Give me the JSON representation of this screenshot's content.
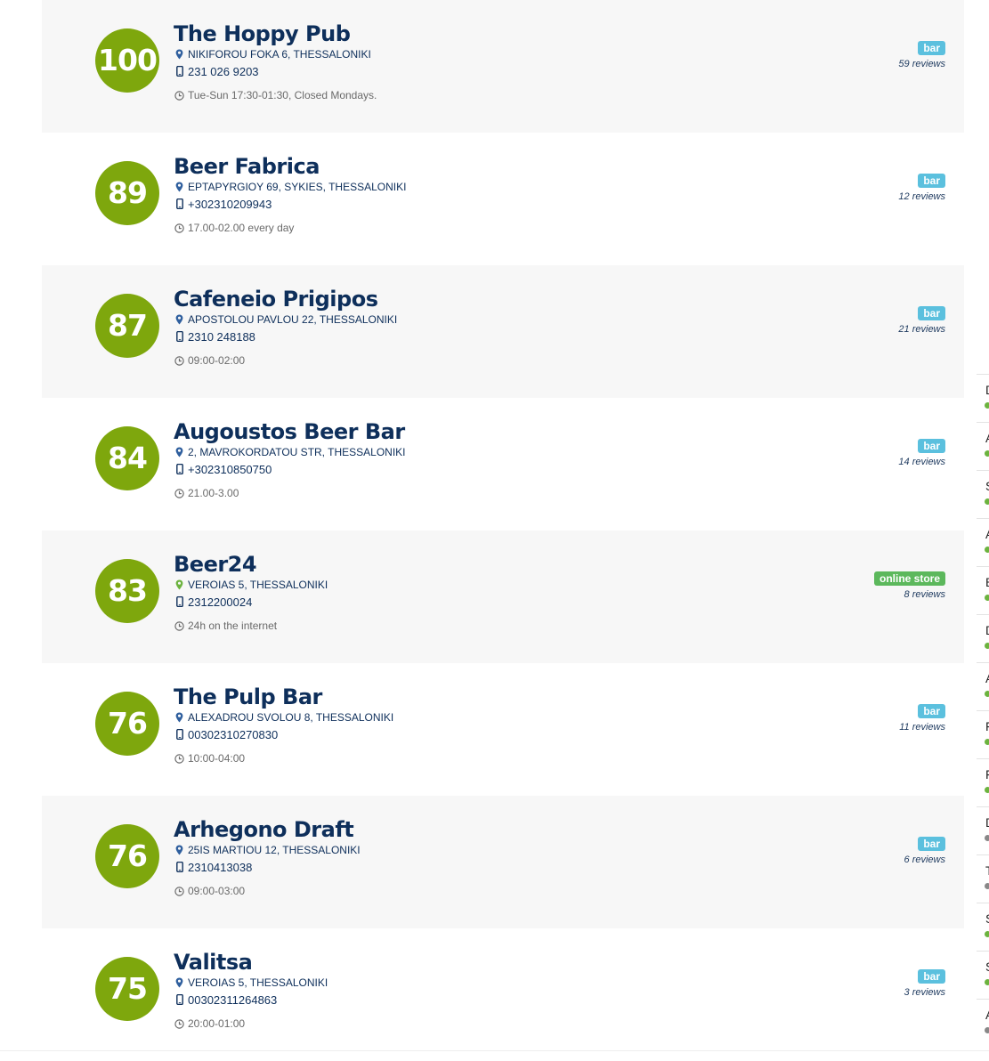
{
  "venues": [
    {
      "score": "100",
      "name": "The Hoppy Pub",
      "address": "NIKIFOROU FOKA 6, THESSALONIKI",
      "phone": "231 026 9203",
      "hours": "Tue-Sun 17:30-01:30, Closed Mondays.",
      "category": "bar",
      "reviews": "59 reviews",
      "pin": "location-pin-icon"
    },
    {
      "score": "89",
      "name": "Beer Fabrica",
      "address": "EPTAPYRGIOY 69, SYKIES, THESSALONIKI",
      "phone": "+302310209943",
      "hours": "17.00-02.00 every day",
      "category": "bar",
      "reviews": "12 reviews",
      "pin": "location-pin-icon"
    },
    {
      "score": "87",
      "name": "Cafeneio Prigipos",
      "address": "APOSTOLOU PAVLOU 22, THESSALONIKI",
      "phone": "2310 248188",
      "hours": "09:00-02:00",
      "category": "bar",
      "reviews": "21 reviews",
      "pin": "location-pin-icon"
    },
    {
      "score": "84",
      "name": "Augoustos Beer Bar",
      "address": "2, MAVROKORDATOU STR, THESSALONIKI",
      "phone": "+302310850750",
      "hours": "21.00-3.00",
      "category": "bar",
      "reviews": "14 reviews",
      "pin": "location-pin-icon"
    },
    {
      "score": "83",
      "name": "Beer24",
      "address": "VEROIAS 5, THESSALONIKI",
      "phone": "2312200024",
      "hours": "24h on the internet",
      "category": "online store",
      "reviews": "8 reviews",
      "pin": "location-pin-icon"
    },
    {
      "score": "76",
      "name": "The Pulp Bar",
      "address": "ALEXADROU SVOLOU 8, THESSALONIKI",
      "phone": "00302310270830",
      "hours": "10:00-04:00",
      "category": "bar",
      "reviews": "11 reviews",
      "pin": "location-pin-icon"
    },
    {
      "score": "76",
      "name": "Arhegono Draft",
      "address": "25IS MARTIOU 12, THESSALONIKI",
      "phone": "2310413038",
      "hours": "09:00-03:00",
      "category": "bar",
      "reviews": "6 reviews",
      "pin": "location-pin-icon"
    },
    {
      "score": "75",
      "name": "Valitsa",
      "address": "VEROIAS 5, THESSALONIKI",
      "phone": "00302311264863",
      "hours": "20:00-01:00",
      "category": "bar",
      "reviews": "3 reviews",
      "pin": "location-pin-icon"
    }
  ],
  "sidebar_letters": [
    "D",
    "A",
    "S",
    "A",
    "B",
    "D",
    "A",
    "F",
    "F",
    "D",
    "T",
    "S",
    "S",
    "A"
  ],
  "colors": {
    "score_circle": "#7ea70d",
    "venue_name": "#0e2f5b",
    "bar_badge": "#5bc0de",
    "online_store_badge": "#5cb85c",
    "location_pin_blue": "#2f5f9e",
    "location_pin_green": "#6cb33f"
  },
  "icons": {
    "address": "location-pin-icon",
    "phone": "mobile-phone-icon",
    "hours": "clock-icon"
  }
}
